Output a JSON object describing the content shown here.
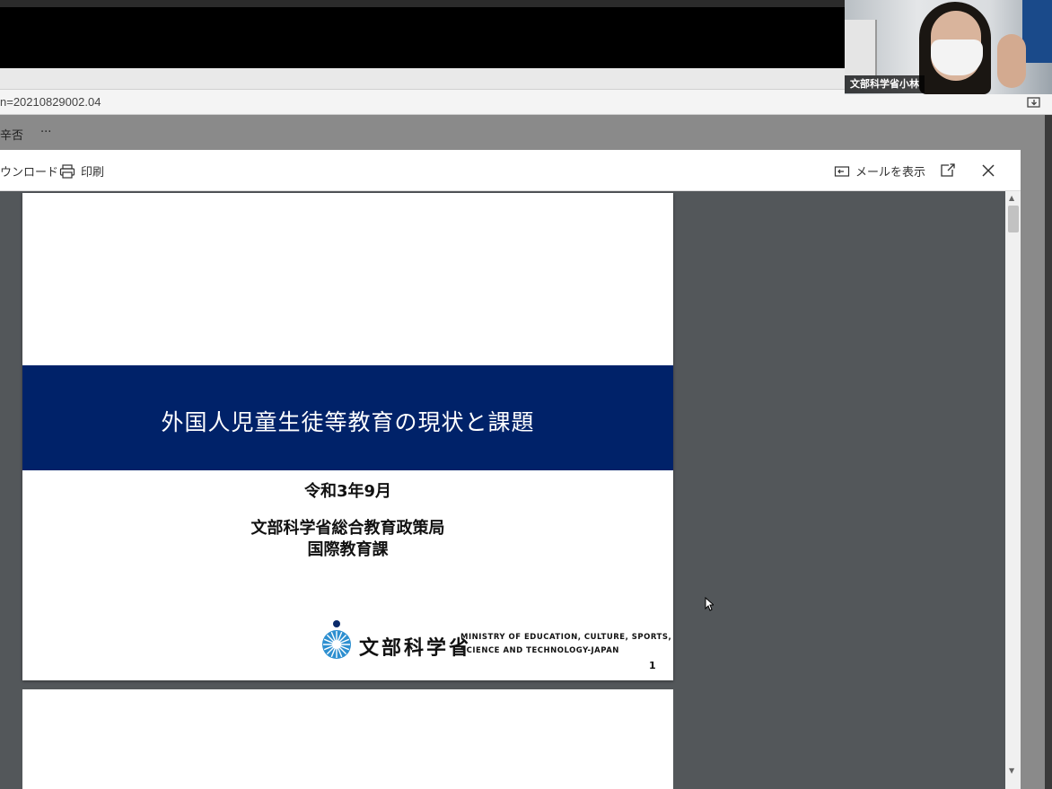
{
  "browser": {
    "url_fragment": "n=20210829002.04"
  },
  "commands": {
    "partial_label": "辛否",
    "more": "···"
  },
  "viewer_toolbar": {
    "download_label": "ウンロード",
    "print_label": "印刷",
    "show_mail_label": "メールを表示"
  },
  "slide": {
    "title": "外国人児童生徒等教育の現状と課題",
    "date": "令和3年9月",
    "org_line1": "文部科学省総合教育政策局",
    "org_line2": "国際教育課",
    "logo_jp": "文部科学省",
    "logo_en_line1": "MINISTRY OF EDUCATION, CULTURE, SPORTS,",
    "logo_en_line2": "SCIENCE AND TECHNOLOGY-JAPAN",
    "page_number": "1",
    "band_color": "#002269"
  },
  "webcam": {
    "participant_name": "文部科学省小林"
  }
}
